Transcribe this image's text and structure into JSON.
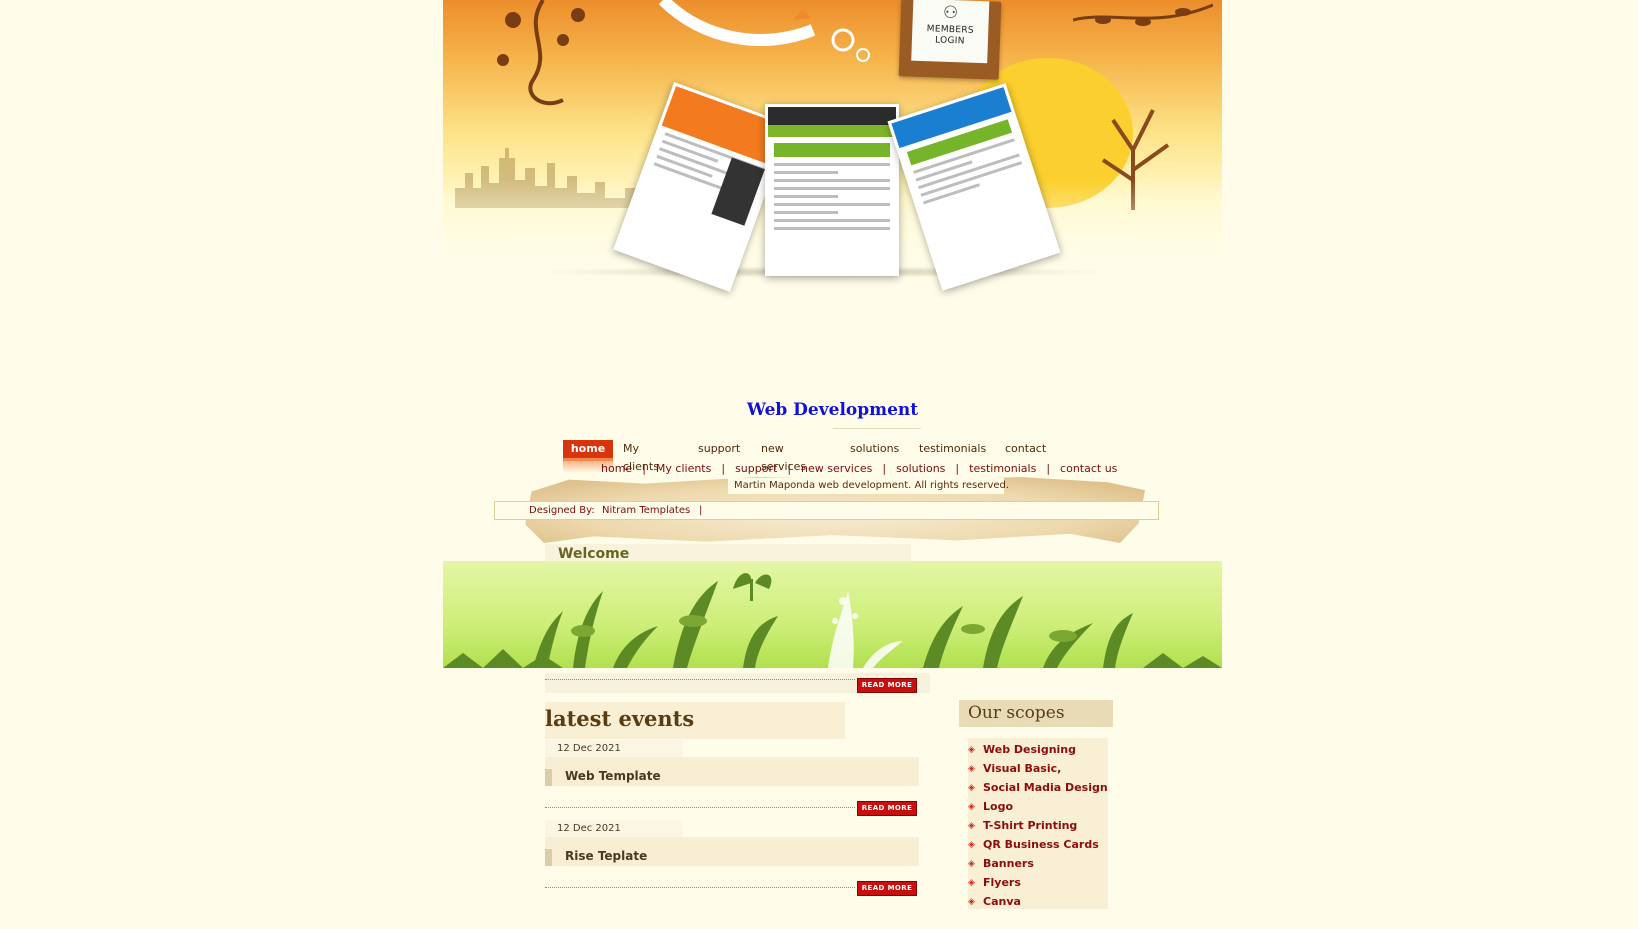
{
  "header": {
    "members_login": [
      "MEMBERS",
      "LOGIN"
    ]
  },
  "site_title": "Web Development",
  "nav_main": [
    "home",
    "My clients",
    "support",
    "new services",
    "solutions",
    "testimonials",
    "contact"
  ],
  "nav_footer": [
    "home",
    "My clients",
    "support",
    "new services",
    "solutions",
    "testimonials",
    "contact us"
  ],
  "footer": {
    "copyright": "Martin Maponda web development. All rights reserved.",
    "designed_label": "Designed By:",
    "designed_value": "Nitram Templates",
    "pipe": "|"
  },
  "welcome": "Welcome",
  "read_more": "READ MORE",
  "events": {
    "title": "latest events",
    "items": [
      {
        "date": "12 Dec 2021",
        "title": "Web Template"
      },
      {
        "date": "12 Dec 2021",
        "title": "Rise Teplate"
      }
    ]
  },
  "scopes": {
    "title": "Our scopes",
    "items": [
      "Web Designing",
      "Visual Basic,",
      "Social Madia Design",
      "Logo",
      "T-Shirt Printing",
      "QR Business Cards",
      "Banners",
      "Flyers",
      "Canva"
    ]
  },
  "colors": {
    "title_blue": "#1010d8",
    "nav_active": "#d8350f",
    "link_red": "#8b0d0d",
    "background": "#fffde9"
  }
}
